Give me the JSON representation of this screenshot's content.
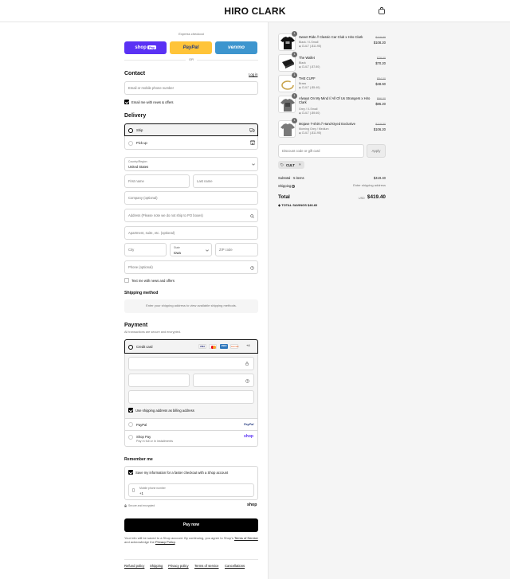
{
  "brand": "HIRO CLARK",
  "express": {
    "title": "Express checkout",
    "shop_pay": "shop",
    "shop_pay_badge": "Pay",
    "paypal": "PayPal",
    "venmo": "venmo",
    "or": "OR"
  },
  "contact": {
    "title": "Contact",
    "login": "Log in",
    "email_placeholder": "Email or mobile phone number",
    "news_label": "Email me with news & offers"
  },
  "delivery": {
    "title": "Delivery",
    "ship": "Ship",
    "pickup": "Pick up",
    "country_label": "Country/Region",
    "country_value": "United States",
    "first_name": "First name",
    "last_name": "Last name",
    "company": "Company (optional)",
    "address": "Address (Please note we do not ship to PO boxes)",
    "apartment": "Apartment, suite, etc. (optional)",
    "city": "City",
    "state_label": "State",
    "state_value": "Iowa",
    "zip": "ZIP code",
    "phone": "Phone (optional)",
    "text_label": "Text me with news and offers"
  },
  "shipping_method": {
    "title": "Shipping method",
    "message": "Enter your shipping address to view available shipping methods."
  },
  "payment": {
    "title": "Payment",
    "subtitle": "All transactions are secure and encrypted.",
    "credit_card": "Credit card",
    "card_more": "+4",
    "cards": [
      {
        "name": "VISA",
        "color": "#ffffff",
        "text": "#1a1f71"
      },
      {
        "name": "MC",
        "color": "#ffffff",
        "text": "#eb001b"
      },
      {
        "name": "AMEX",
        "color": "#2e77bc",
        "text": "#ffffff"
      },
      {
        "name": "DISCOVER",
        "color": "#ffffff",
        "text": "#e55c20"
      }
    ],
    "billing_label": "Use shipping address as billing address",
    "paypal": "PayPal",
    "paypal_logo": "PayPal",
    "shop_pay": "Shop Pay",
    "shop_pay_sub": "Pay in full or in installments",
    "shop_pay_logo": "shop"
  },
  "remember": {
    "title": "Remember me",
    "save_label": "Save my information for a faster checkout with a Shop account",
    "phone_label": "Mobile phone number",
    "phone_value": "+1",
    "secure": "Secure and encrypted",
    "shop_logo": "shop"
  },
  "pay_now": "Pay now",
  "legal": {
    "prefix": "Your info will be saved to a Shop account. By continuing, you agree to Shop's",
    "terms": "Terms of Service",
    "middle": "and acknowledge the",
    "privacy": "Privacy Policy",
    "suffix": "."
  },
  "footer_links": [
    "Refund policy",
    "Shipping",
    "Privacy policy",
    "Terms of service",
    "Cancellations"
  ],
  "cart": {
    "items": [
      {
        "qty": "1",
        "name": "Sweet Ride // Classic Car Club x Hiro Clark",
        "variant": "Black / X-Small",
        "discount": "CULT (-$11.95)",
        "original": "$119.50",
        "price": "$108.20"
      },
      {
        "qty": "1",
        "name": "The Wallet",
        "variant": "Black",
        "discount": "CULT (-$7.80)",
        "original": "$78.00",
        "price": "$70.20"
      },
      {
        "qty": "1",
        "name": "THE CUFF",
        "variant": "Brass",
        "discount": "CULT (-$5.40)",
        "original": "$54.00",
        "price": "$48.60"
      },
      {
        "qty": "1",
        "name": "Always On My Mind // All Of Us Strangers x Hiro Clark",
        "variant": "Grey / X-Small",
        "discount": "CULT (-$9.60)",
        "original": "$96.00",
        "price": "$86.20"
      },
      {
        "qty": "1",
        "name": "Mojave T-shirt // Hand-Dyed Exclusive",
        "variant": "Morning Grey / Medium",
        "discount": "CULT (-$11.95)",
        "original": "$119.50",
        "price": "$106.20"
      }
    ],
    "discount_placeholder": "Discount code or gift card",
    "apply": "Apply",
    "applied_code": "CULT",
    "subtotal_label": "Subtotal · 5 items",
    "subtotal_value": "$419.40",
    "shipping_label": "Shipping",
    "shipping_value": "Enter shipping address",
    "total_label": "Total",
    "currency": "USD",
    "total_value": "$419.40",
    "savings_label": "TOTAL SAVINGS",
    "savings_value": "$46.60"
  }
}
